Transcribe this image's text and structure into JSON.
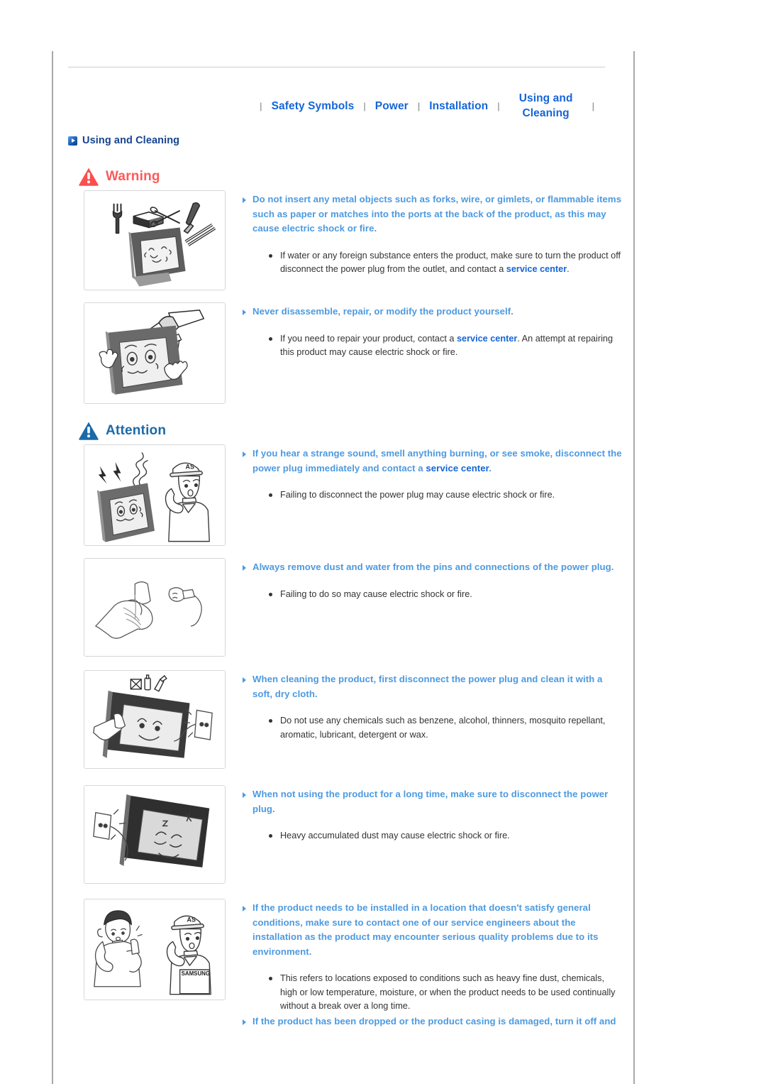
{
  "nav": {
    "separator": "|",
    "items": [
      {
        "label": "Safety Symbols",
        "two_line": false
      },
      {
        "label": "Power",
        "two_line": false
      },
      {
        "label": "Installation",
        "two_line": false
      },
      {
        "label": "Using and\nCleaning",
        "two_line": true
      }
    ]
  },
  "section": {
    "title": "Using and Cleaning",
    "marker_icon": "blue-arrow-marker-icon"
  },
  "banners": {
    "warning": {
      "label": "Warning",
      "icon": "warning-triangle-icon",
      "color": "#fc5a5a"
    },
    "attention": {
      "label": "Attention",
      "icon": "attention-triangle-icon",
      "color": "#1b6aa8"
    }
  },
  "blocks": [
    {
      "image_name": "metal-objects-in-ports-illustration",
      "headline_pre": "Do not insert any metal objects such as forks, wire, or gimlets, or flammable items such as paper or matches into the ports at the back of the product, as this may cause electric shock or fire.",
      "headline_link": "",
      "headline_post": "",
      "sub_pre": "If water or any foreign substance enters the product, make sure to turn the product off disconnect the power plug from the outlet, and contact a ",
      "sub_link": "service center",
      "sub_post": "."
    },
    {
      "image_name": "do-not-disassemble-illustration",
      "headline_pre": "Never disassemble, repair, or modify the product yourself.",
      "headline_link": "",
      "headline_post": "",
      "sub_pre": "If you need to repair your product, contact a ",
      "sub_link": "service center",
      "sub_post": ". An attempt at repairing this product may cause electric shock or fire."
    },
    {
      "image_name": "smoke-strange-sound-call-service-illustration",
      "headline_pre": "If you hear a strange sound, smell anything burning, or see smoke, disconnect the power plug immediately and contact a ",
      "headline_link": "service center",
      "headline_post": ".",
      "sub_pre": "Failing to disconnect the power plug may cause electric shock or fire.",
      "sub_link": "",
      "sub_post": ""
    },
    {
      "image_name": "clean-power-plug-pins-illustration",
      "headline_pre": "Always remove dust and water from the pins and connections of the power plug.",
      "headline_link": "",
      "headline_post": "",
      "sub_pre": "Failing to do so may cause electric shock or fire.",
      "sub_link": "",
      "sub_post": ""
    },
    {
      "image_name": "clean-with-soft-dry-cloth-illustration",
      "headline_pre": "When cleaning the product, first disconnect the power plug and clean it with a soft, dry cloth.",
      "headline_link": "",
      "headline_post": "",
      "sub_pre": "Do not use any chemicals such as benzene, alcohol, thinners, mosquito repellant, aromatic, lubricant, detergent or wax.",
      "sub_link": "",
      "sub_post": ""
    },
    {
      "image_name": "disconnect-plug-when-unused-illustration",
      "headline_pre": "When not using the product for a long time, make sure to disconnect the power plug.",
      "headline_link": "",
      "headline_post": "",
      "sub_pre": "Heavy accumulated dust may cause electric shock or fire.",
      "sub_link": "",
      "sub_post": ""
    },
    {
      "image_name": "contact-service-engineer-illustration",
      "headline_pre": "If the product needs to be installed in a location that doesn't satisfy general conditions, make sure to contact one of our service engineers about the installation as the product may encounter serious quality problems due to its environment.",
      "headline_link": "",
      "headline_post": "",
      "sub_pre": "This refers to locations exposed to conditions such as heavy fine dust, chemicals, high or low temperature, moisture, or when the product needs to be used continually without a break over a long time.",
      "sub_link": "",
      "sub_post": ""
    }
  ],
  "trailing_headline": "If the product has been dropped or the product casing is damaged, turn it off and",
  "illustration_text": {
    "as_cap": "AS",
    "samsung_label": "SAMSUNG"
  }
}
